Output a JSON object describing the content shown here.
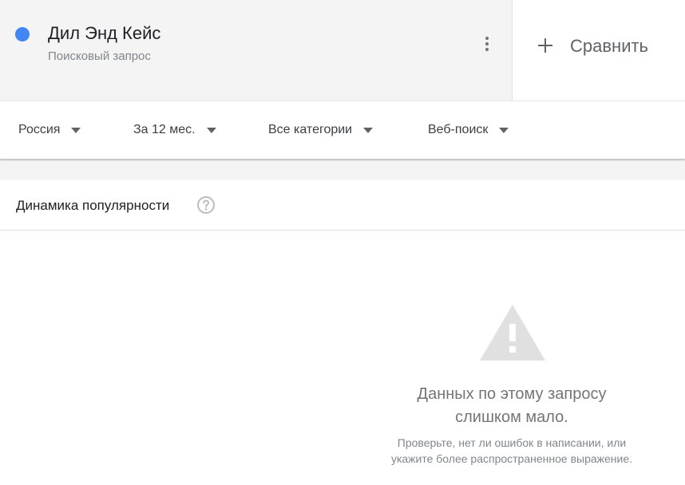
{
  "term": {
    "title": "Дил Энд Кейс",
    "subtitle": "Поисковый запрос",
    "dot_color": "#4285f4"
  },
  "icons": {
    "more": "more-vert-icon",
    "compare": "plus-icon",
    "help": "help-circle-icon",
    "warning": "warning-triangle-icon",
    "dropdown": "caret-down-icon"
  },
  "compare": {
    "label": "Сравнить"
  },
  "filters": {
    "region": "Россия",
    "period": "За 12 мес.",
    "category": "Все категории",
    "search_type": "Веб-поиск"
  },
  "widget": {
    "title": "Динамика популярности",
    "empty_title_line1": "Данных по этому запросу",
    "empty_title_line2": "слишком мало.",
    "empty_hint_line1": "Проверьте, нет ли ошибок в написании, или",
    "empty_hint_line2": "укажите более распространенное выражение."
  }
}
